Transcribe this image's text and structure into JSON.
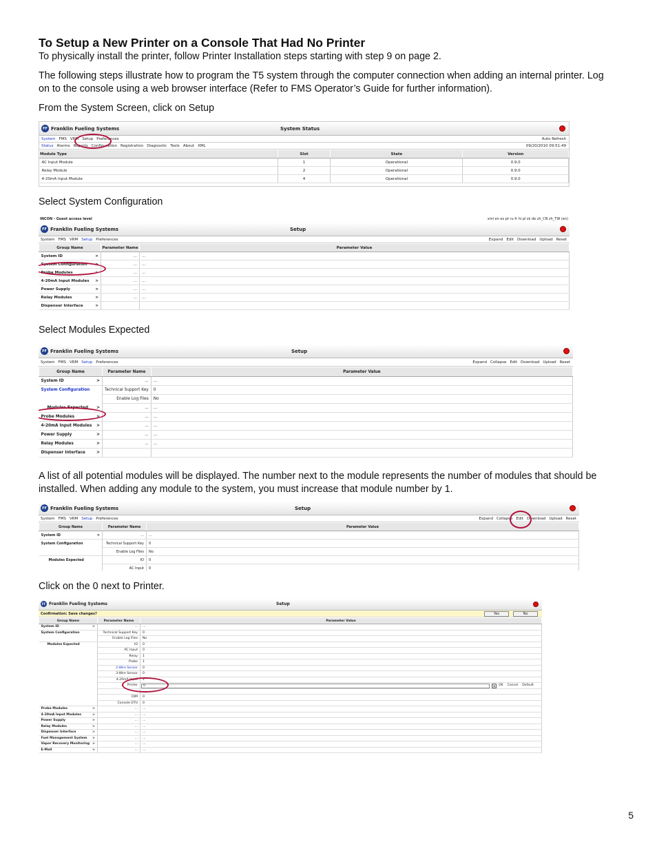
{
  "heading": "To Setup a New Printer on a Console That Had No Printer",
  "para1": "To physically install the printer, follow Printer Installation steps starting with step 9 on page 2.",
  "para2": "The following steps illustrate how to program the T5 system through the computer connection when adding an internal printer. Log on to the console using a web browser interface (Refer to FMS Operator’s Guide for further information).",
  "step1": "From the System Screen, click on Setup",
  "step2": "Select System Configuration",
  "step3": "Select Modules Expected",
  "step4": "A list of all potential modules will be displayed. The number next to the module represents the number of modules that should be installed. When adding any module to the system, you must increase that module number by 1.",
  "step5": "Click on the 0 next to Printer.",
  "page_number": "5",
  "brand": "Franklin Fueling Systems",
  "logo_mark": "FF",
  "shot1": {
    "title": "System Status",
    "nav": [
      "System",
      "FMS",
      "VRM",
      "Setup",
      "Preferences"
    ],
    "auto_refresh": "Auto Refresh",
    "subnav": [
      "Status",
      "Alarms",
      "Reports",
      "Configuration",
      "Registration",
      "Diagnostic",
      "Tools",
      "About",
      "XML"
    ],
    "timestamp": "09/20/2010 09:51:49",
    "cols": [
      "Module Type",
      "Slot",
      "State",
      "Version"
    ],
    "rows": [
      [
        "AC Input Module",
        "1",
        "Operational",
        "0.9.0"
      ],
      [
        "Relay Module",
        "2",
        "Operational",
        "0.9.0"
      ],
      [
        "4-20mA Input Module",
        "4",
        "Operational",
        "0.9.0"
      ]
    ]
  },
  "shot2": {
    "access": "INCON - Guest access level",
    "langs": "xml en es pt ru fr hi pl sk de zh_CN zh_TW (en)",
    "title": "Setup",
    "nav": [
      "System",
      "FMS",
      "VRM",
      "Setup",
      "Preferences"
    ],
    "actions": [
      "Expand",
      "Edit",
      "Download",
      "Upload",
      "Reset"
    ],
    "cols": [
      "Group Name",
      "Parameter Name",
      "Parameter Value"
    ],
    "rows": [
      "System ID",
      "System Configuration",
      "Probe Modules",
      "4-20mA Input Modules",
      "Power Supply",
      "Relay Modules",
      "Dispenser Interface"
    ],
    "arrow": ">",
    "dots": "..."
  },
  "shot3": {
    "title": "Setup",
    "nav": [
      "System",
      "FMS",
      "VRM",
      "Setup",
      "Preferences"
    ],
    "actions": [
      "Expand",
      "Collapse",
      "Edit",
      "Download",
      "Upload",
      "Reset"
    ],
    "cols": [
      "Group Name",
      "Parameter Name",
      "Parameter Value"
    ],
    "sysid": "System ID",
    "syscfg": "System Configuration",
    "tech_key": "Technical Support Key",
    "tech_val": "0",
    "log_key": "Enable Log Files",
    "log_val": "No",
    "mod_exp": "Modules Expected",
    "rows": [
      "Probe Modules",
      "4-20mA Input Modules",
      "Power Supply",
      "Relay Modules",
      "Dispenser Interface"
    ]
  },
  "shot4": {
    "title": "Setup",
    "nav": [
      "System",
      "FMS",
      "VRM",
      "Setup",
      "Preferences"
    ],
    "actions": [
      "Expand",
      "Collapse",
      "Edit",
      "Download",
      "Upload",
      "Reset"
    ],
    "cols": [
      "Group Name",
      "Parameter Name",
      "Parameter Value"
    ],
    "sysid": "System ID",
    "syscfg": "System Configuration",
    "tech_key": "Technical Support Key",
    "tech_val": "0",
    "log_key": "Enable Log Files",
    "log_val": "No",
    "mod_exp": "Modules Expected",
    "io_key": "IO",
    "io_val": "0",
    "ac_key": "AC Input",
    "ac_val": "0"
  },
  "shot5": {
    "title": "Setup",
    "confirm": "Confirmation:  Save changes?",
    "yes": "Yes",
    "no": "No",
    "cols": [
      "Group Name",
      "Parameter Name",
      "Parameter Value"
    ],
    "sysid": "System ID",
    "syscfg": "System Configuration",
    "tech_key": "Technical Support Key",
    "tech_val": "0",
    "log_key": "Enable Log Files",
    "log_val": "No",
    "mod_exp": "Modules Expected",
    "modules": [
      [
        "IO",
        "0"
      ],
      [
        "AC Input",
        "0"
      ],
      [
        "Relay",
        "1"
      ],
      [
        "Probe",
        "1"
      ],
      [
        "2-Wire Sensor",
        "0"
      ],
      [
        "3-Wire Sensor",
        "0"
      ],
      [
        "4-20mA Input",
        "1"
      ],
      [
        "Printer",
        "0"
      ],
      [
        "",
        ""
      ],
      [
        "DIM",
        "0"
      ],
      [
        "Console DTU",
        "0"
      ]
    ],
    "edit_actions": [
      "OK",
      "Cancel",
      "Default"
    ],
    "groups": [
      "Probe Modules",
      "4-20mA Input Modules",
      "Power Supply",
      "Relay Modules",
      "Dispenser Interface",
      "Fuel Management System",
      "Vapor Recovery Monitoring",
      "E-Mail"
    ]
  }
}
